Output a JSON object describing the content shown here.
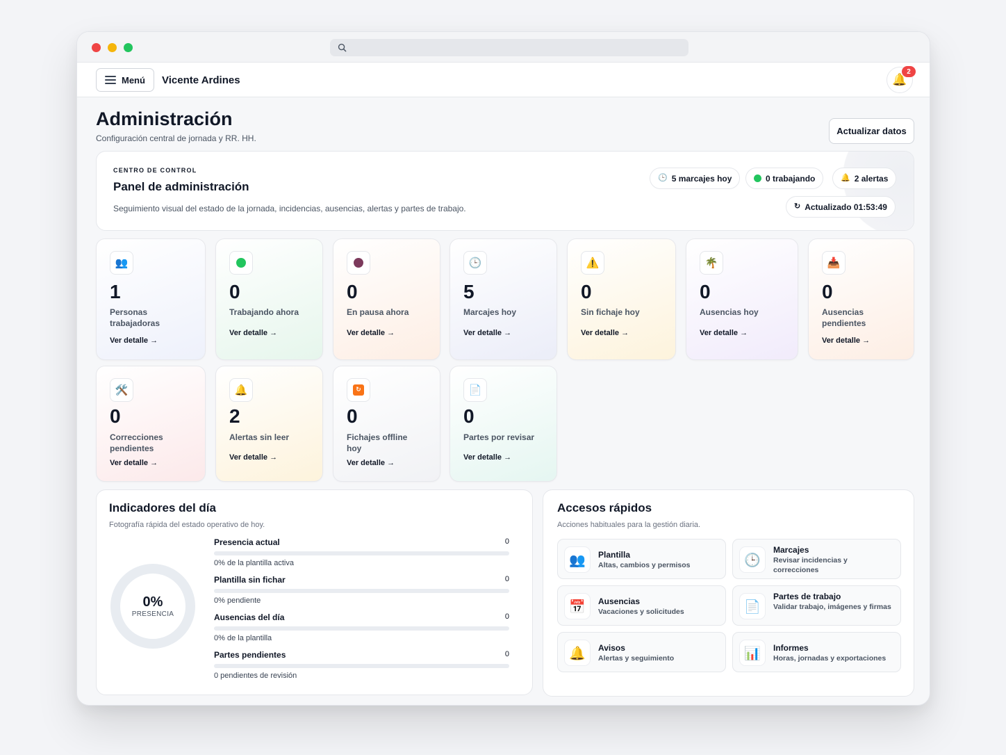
{
  "app": {
    "user_name": "Vicente Ardines",
    "menu_label": "Menú",
    "notifications_count": "2"
  },
  "header": {
    "title": "Administración",
    "subtitle": "Configuración central de jornada y RR. HH.",
    "refresh_label": "Actualizar datos"
  },
  "control_panel": {
    "kicker": "CENTRO DE CONTROL",
    "title": "Panel de administración",
    "description": "Seguimiento visual del estado de la jornada, incidencias, ausencias, alertas y partes de trabajo.",
    "pills": {
      "marcajes": "5 marcajes hoy",
      "trabajando": "0 trabajando",
      "alertas": "2 alertas",
      "actualizado": "Actualizado 01:53:49"
    }
  },
  "stats": [
    {
      "icon": "people-icon",
      "value": "1",
      "label": "Personas trabajadoras",
      "link": "Ver detalle →"
    },
    {
      "icon": "green-dot-icon",
      "value": "0",
      "label": "Trabajando ahora",
      "link": "Ver detalle →"
    },
    {
      "icon": "pause-icon",
      "value": "0",
      "label": "En pausa ahora",
      "link": "Ver detalle →"
    },
    {
      "icon": "clock-icon",
      "value": "5",
      "label": "Marcajes hoy",
      "link": "Ver detalle →"
    },
    {
      "icon": "warning-icon",
      "value": "0",
      "label": "Sin fichaje hoy",
      "link": "Ver detalle →"
    },
    {
      "icon": "palm-tree-icon",
      "value": "0",
      "label": "Ausencias hoy",
      "link": "Ver detalle →"
    },
    {
      "icon": "inbox-icon",
      "value": "0",
      "label": "Ausencias pendientes",
      "link": "Ver detalle →"
    },
    {
      "icon": "tools-icon",
      "value": "0",
      "label": "Correcciones pendientes",
      "link": "Ver detalle →"
    },
    {
      "icon": "bell-icon",
      "value": "2",
      "label": "Alertas sin leer",
      "link": "Ver detalle →"
    },
    {
      "icon": "offline-icon",
      "value": "0",
      "label": "Fichajes offline hoy",
      "link": "Ver detalle →"
    },
    {
      "icon": "document-icon",
      "value": "0",
      "label": "Partes por revisar",
      "link": "Ver detalle →"
    }
  ],
  "indicators": {
    "title": "Indicadores del día",
    "subtitle": "Fotografía rápida del estado operativo de hoy.",
    "donut_value": "0%",
    "donut_label": "PRESENCIA",
    "rows": [
      {
        "name": "Presencia actual",
        "value": "0",
        "fraction": 0,
        "note": "0% de la plantilla activa"
      },
      {
        "name": "Plantilla sin fichar",
        "value": "0",
        "fraction": 0,
        "note": "0% pendiente"
      },
      {
        "name": "Ausencias del día",
        "value": "0",
        "fraction": 0,
        "note": "0% de la plantilla"
      },
      {
        "name": "Partes pendientes",
        "value": "0",
        "fraction": 0,
        "note": "0 pendientes de revisión"
      }
    ]
  },
  "quick_access": {
    "title": "Accesos rápidos",
    "subtitle": "Acciones habituales para la gestión diaria.",
    "items": [
      {
        "icon": "people-icon",
        "title": "Plantilla",
        "desc": "Altas, cambios y permisos"
      },
      {
        "icon": "clock-icon",
        "title": "Marcajes",
        "desc": "Revisar incidencias y correcciones"
      },
      {
        "icon": "calendar-icon",
        "title": "Ausencias",
        "desc": "Vacaciones y solicitudes"
      },
      {
        "icon": "document-icon",
        "title": "Partes de trabajo",
        "desc": "Validar trabajo, imágenes y firmas"
      },
      {
        "icon": "bell-icon",
        "title": "Avisos",
        "desc": "Alertas y seguimiento"
      },
      {
        "icon": "chart-icon",
        "title": "Informes",
        "desc": "Horas, jornadas y exportaciones"
      }
    ]
  }
}
